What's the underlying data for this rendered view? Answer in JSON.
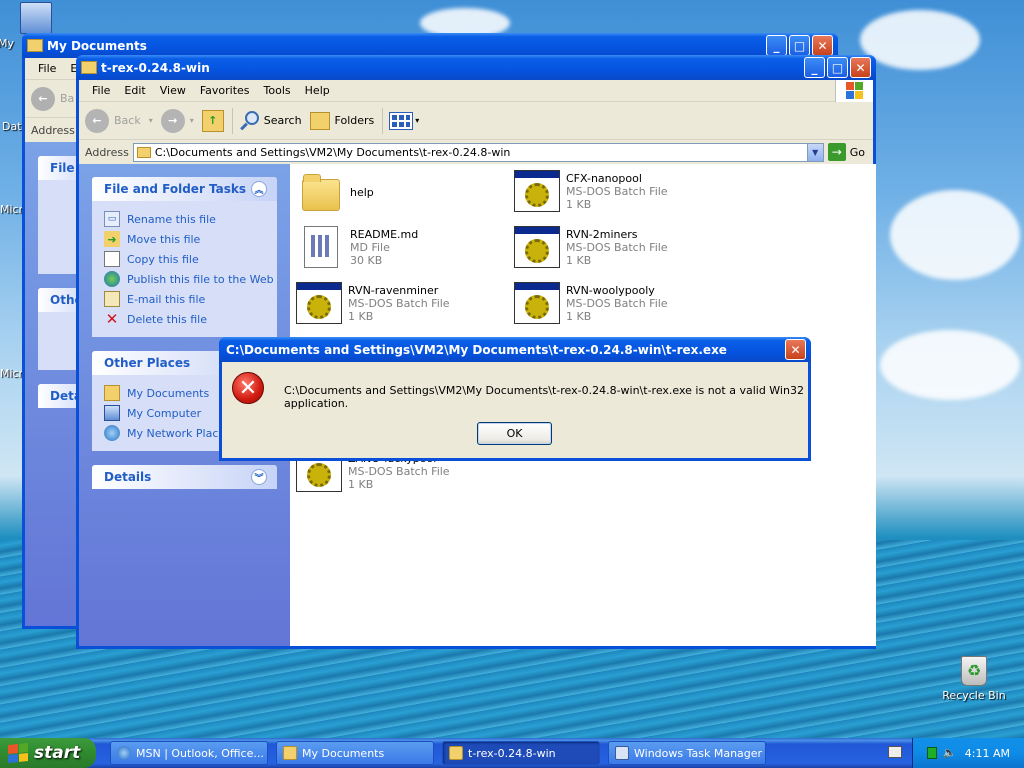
{
  "desktop": {
    "icons": [
      {
        "label": "My"
      },
      {
        "label": "Dat"
      },
      {
        "label": "Micr"
      },
      {
        "label": "Micr"
      },
      {
        "label": "Recycle Bin"
      }
    ]
  },
  "back_window": {
    "title": "My Documents",
    "menu": [
      "File",
      "E"
    ],
    "back_label": "Ba",
    "address_label": "Address",
    "box1_head": "File a",
    "box2_head": "Othe",
    "box3_head": "Deta"
  },
  "window": {
    "title": "t-rex-0.24.8-win",
    "menu": [
      "File",
      "Edit",
      "View",
      "Favorites",
      "Tools",
      "Help"
    ],
    "toolbar": {
      "back": "Back",
      "search": "Search",
      "folders": "Folders"
    },
    "address": {
      "label": "Address",
      "value": "C:\\Documents and Settings\\VM2\\My Documents\\t-rex-0.24.8-win",
      "go": "Go"
    },
    "tasks": {
      "head": "File and Folder Tasks",
      "items": [
        "Rename this file",
        "Move this file",
        "Copy this file",
        "Publish this file to the Web",
        "E-mail this file",
        "Delete this file"
      ]
    },
    "places": {
      "head": "Other Places",
      "items": [
        "My Documents",
        "My Computer",
        "My Network Places"
      ]
    },
    "details": {
      "head": "Details"
    },
    "files": [
      {
        "name": "help",
        "type": "",
        "size": ""
      },
      {
        "name": "CFX-nanopool",
        "type": "MS-DOS Batch File",
        "size": "1 KB"
      },
      {
        "name": "README.md",
        "type": "MD File",
        "size": "30 KB"
      },
      {
        "name": "RVN-2miners",
        "type": "MS-DOS Batch File",
        "size": "1 KB"
      },
      {
        "name": "RVN-ravenminer",
        "type": "MS-DOS Batch File",
        "size": "1 KB"
      },
      {
        "name": "RVN-woolypooly",
        "type": "MS-DOS Batch File",
        "size": "1 KB"
      },
      {
        "name": "ZANO-luckypool",
        "type": "MS-DOS Batch File",
        "size": "1 KB"
      }
    ]
  },
  "dialog": {
    "title": "C:\\Documents and Settings\\VM2\\My Documents\\t-rex-0.24.8-win\\t-rex.exe",
    "message": "C:\\Documents and Settings\\VM2\\My Documents\\t-rex-0.24.8-win\\t-rex.exe is not a valid Win32 application.",
    "ok": "OK"
  },
  "taskbar": {
    "start": "start",
    "tasks": [
      "MSN | Outlook, Office...",
      "My Documents",
      "t-rex-0.24.8-win",
      "Windows Task Manager"
    ],
    "clock": "4:11 AM"
  }
}
